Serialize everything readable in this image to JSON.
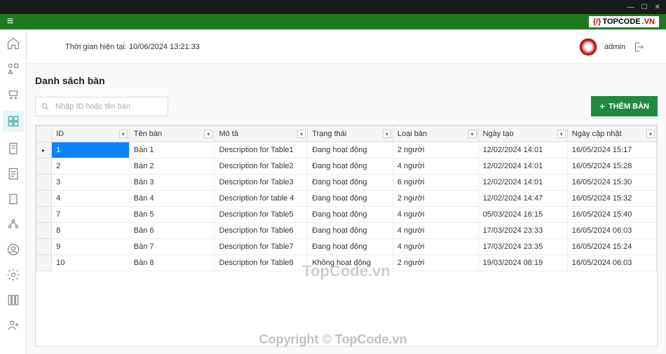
{
  "window_controls": {
    "min": "—",
    "max": "☐",
    "close": "✕"
  },
  "brand": {
    "prefix": "{/}",
    "name": "TOPCODE",
    "suffix": ".VN"
  },
  "header": {
    "time_label": "Thời gian hiện tại: 10/06/2024 13:21:33",
    "username": "admin"
  },
  "page": {
    "title": "Danh sách bàn",
    "search_placeholder": "Nhập ID hoặc tên bàn",
    "add_button": "THÊM BÀN"
  },
  "columns": {
    "id": "ID",
    "name": "Tên bàn",
    "desc": "Mô tả",
    "status": "Trạng thái",
    "type": "Loại bàn",
    "created": "Ngày tạo",
    "updated": "Ngày cập nhật"
  },
  "rows": [
    {
      "id": "1",
      "name": "Bàn 1",
      "desc": "Description for Table1",
      "status": "Đang hoạt động",
      "type": "2 người",
      "created": "12/02/2024 14:01",
      "updated": "16/05/2024 15:17"
    },
    {
      "id": "2",
      "name": "Bàn 2",
      "desc": "Description for Table2",
      "status": "Đang hoạt động",
      "type": "4 người",
      "created": "12/02/2024 14:01",
      "updated": "16/05/2024 15:28"
    },
    {
      "id": "3",
      "name": "Bàn 3",
      "desc": "Description for Table3",
      "status": "Đang hoạt động",
      "type": "6 người",
      "created": "12/02/2024 14:01",
      "updated": "16/05/2024 15:30"
    },
    {
      "id": "4",
      "name": "Bàn 4",
      "desc": "Description for table 4",
      "status": "Đang hoạt động",
      "type": "2 người",
      "created": "12/02/2024 14:47",
      "updated": "16/05/2024 15:32"
    },
    {
      "id": "7",
      "name": "Bàn 5",
      "desc": "Description for Table5",
      "status": "Đang hoạt động",
      "type": "4 người",
      "created": "05/03/2024 16:15",
      "updated": "16/05/2024 15:40"
    },
    {
      "id": "8",
      "name": "Bàn 6",
      "desc": "Description for Table6",
      "status": "Đang hoạt động",
      "type": "4 người",
      "created": "17/03/2024 23:33",
      "updated": "16/05/2024 06:03"
    },
    {
      "id": "9",
      "name": "Bàn 7",
      "desc": "Description for Table7",
      "status": "Đang hoạt động",
      "type": "4 người",
      "created": "17/03/2024 23:35",
      "updated": "16/05/2024 15:24"
    },
    {
      "id": "10",
      "name": "Bàn 8",
      "desc": "Description for Table8",
      "status": "Không hoạt động",
      "type": "2 người",
      "created": "19/03/2024 08:19",
      "updated": "16/05/2024 06:03"
    }
  ],
  "watermarks": {
    "center": "TopCode.vn",
    "bottom": "Copyright © TopCode.vn"
  }
}
